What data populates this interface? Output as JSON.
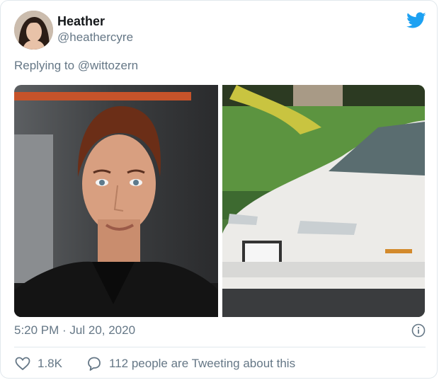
{
  "author": {
    "name": "Heather",
    "handle": "@heathercyre"
  },
  "reply": {
    "prefix": "Replying to ",
    "mention": "@wittozern"
  },
  "media": {
    "left_image": "portrait-photo",
    "right_image": "white-car-photo"
  },
  "timestamp": "5:20 PM · Jul 20, 2020",
  "stats": {
    "likes": "1.8K",
    "talking": "112 people are Tweeting about this"
  },
  "colors": {
    "twitter_blue": "#1da1f2",
    "muted_text": "#657786"
  }
}
